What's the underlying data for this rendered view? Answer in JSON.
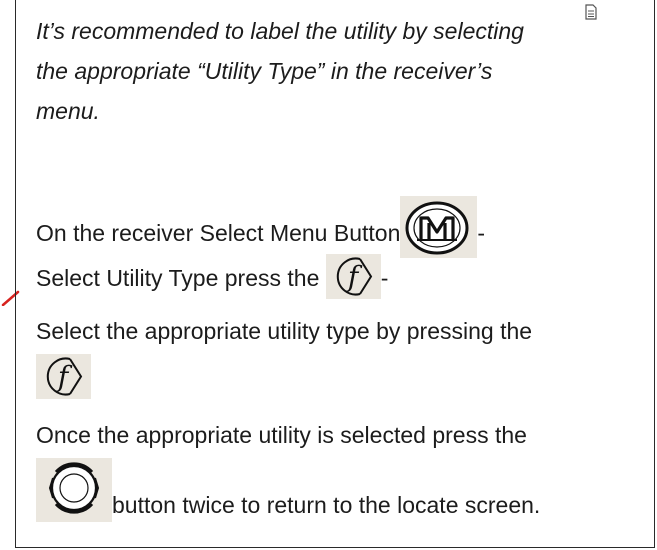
{
  "note": {
    "lines": [
      "It’s recommended to label the utility by selecting",
      "the appropriate “Utility Type” in the receiver’s",
      "menu."
    ]
  },
  "steps": {
    "menu": {
      "before": "On the receiver Select Menu Button",
      "after": "-"
    },
    "utility_type": {
      "before": "Select Utility Type press the ",
      "after": "-"
    },
    "select_type": {
      "line1": "Select the appropriate utility type by pressing the"
    },
    "return": {
      "line1": "Once the appropriate utility is selected press the",
      "line2": " button twice to return to the locate screen."
    }
  },
  "icons": {
    "menu_button": "menu-m-button-icon",
    "note": "note-icon",
    "function_button": "function-f-button-icon",
    "navigate_button": "navigate-circle-button-icon"
  },
  "colors": {
    "text": "#1c1c1c",
    "border": "#2a2a2a",
    "icon_bg": "#ebe7df",
    "accent_mark": "#d7231f"
  }
}
